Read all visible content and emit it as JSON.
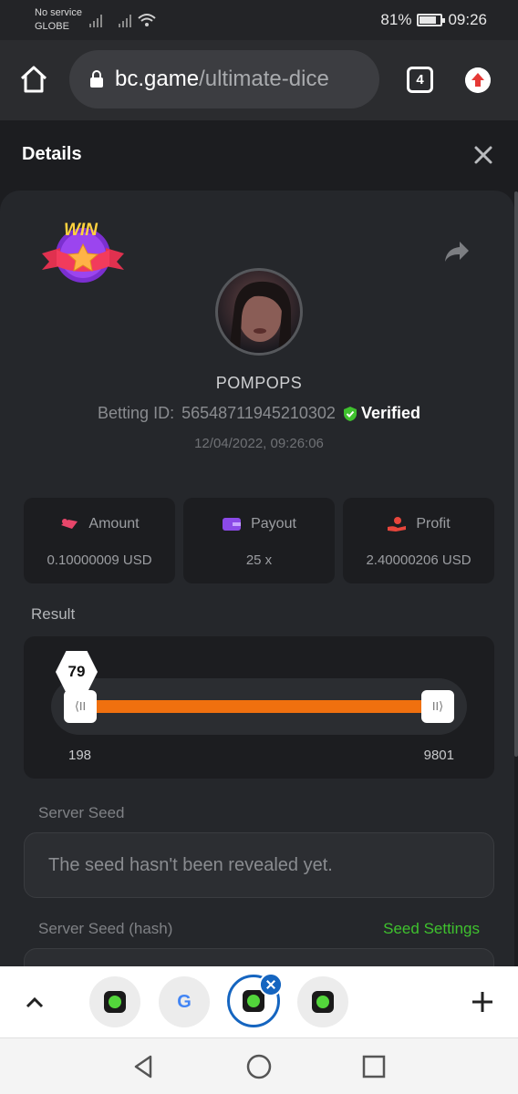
{
  "status_bar": {
    "carrier_line1": "No service",
    "carrier_line2": "GLOBE",
    "battery": "81%",
    "battery_level": 0.81,
    "time": "09:26"
  },
  "browser": {
    "url_host": "bc.game",
    "url_path": "/ultimate-dice",
    "tab_count": "4"
  },
  "panel": {
    "title": "Details",
    "badge": "WIN",
    "username": "POMPOPS",
    "betting_id_label": "Betting ID:",
    "betting_id": "56548711945210302",
    "verified": "Verified",
    "date": "12/04/2022, 09:26:06"
  },
  "stats": [
    {
      "label": "Amount",
      "value": "0.10000009 USD",
      "icon": "money-icon",
      "color": "#e8466a"
    },
    {
      "label": "Payout",
      "value": "25 x",
      "icon": "wallet-icon",
      "color": "#8b4ae8"
    },
    {
      "label": "Profit",
      "value": "2.40000206 USD",
      "icon": "hand-coin-icon",
      "color": "#e8463c"
    }
  ],
  "result": {
    "label": "Result",
    "roll": "79",
    "range_min": "198",
    "range_max": "9801",
    "bar_color": "#f0700f"
  },
  "server_seed": {
    "label": "Server Seed",
    "value": "The seed hasn't been revealed yet."
  },
  "server_seed_hash": {
    "label": "Server Seed (hash)",
    "link": "Seed Settings"
  },
  "colors": {
    "accent_green": "#3fc12e",
    "tab_active_blue": "#1565c0"
  }
}
